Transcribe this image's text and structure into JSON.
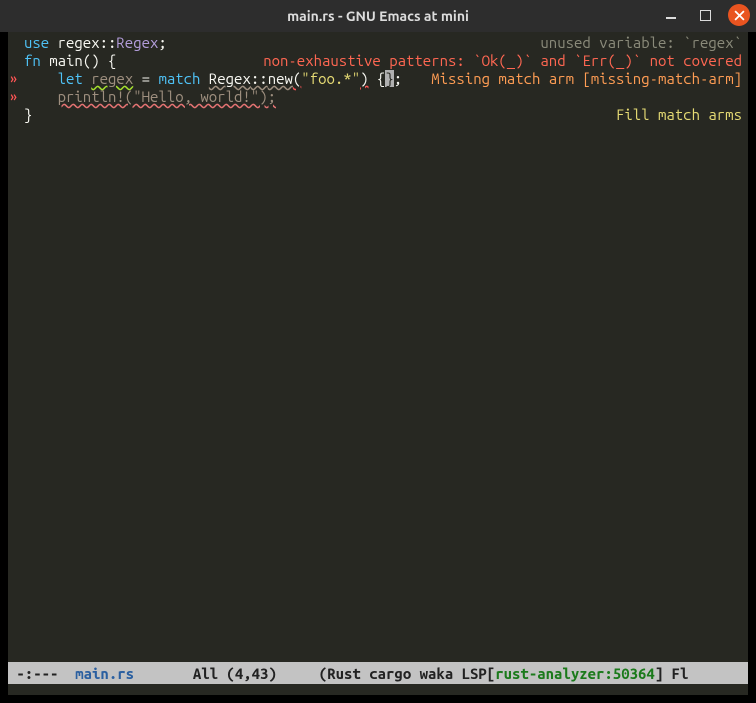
{
  "titlebar": {
    "title": "main.rs - GNU Emacs at mini"
  },
  "gutter": {
    "mark1": "»",
    "mark2": "»"
  },
  "code": {
    "l1_use": "use",
    "l1_path": " regex::",
    "l1_type": "Regex",
    "l1_semi": ";",
    "l2_fn": "fn",
    "l2_sig": " main() {",
    "l3_indent": "    ",
    "l3_let": "let",
    "l3_sp1": " ",
    "l3_var": "regex",
    "l3_eq": " = ",
    "l3_match": "match",
    "l3_sp2": " ",
    "l3_regex": "Regex",
    "l3_ns": "::",
    "l3_new": "new",
    "l3_lp": "(",
    "l3_str": "\"foo.*\"",
    "l3_rp": ")",
    "l3_sp3": " ",
    "l3_lb": "{",
    "l3_cursor": "}",
    "l3_semi": ";",
    "l4_indent": "    ",
    "l4_call": "println!(\"Hello, world!\");",
    "l5_close": "}"
  },
  "overlays": {
    "unused": "unused variable: `regex`",
    "nonexh": "non-exhaustive patterns: `Ok(_)` and `Err(_)` not covered",
    "missing": "Missing match arm [missing-match-arm]",
    "fill": "Fill match arms"
  },
  "modeline": {
    "left": " -:--- ",
    "buffer": " main.rs ",
    "pos": "      All (4,43)     ",
    "modes_a": "(Rust cargo waka LSP[",
    "ra": "rust-analyzer:50364",
    "modes_b": "] Fl"
  }
}
